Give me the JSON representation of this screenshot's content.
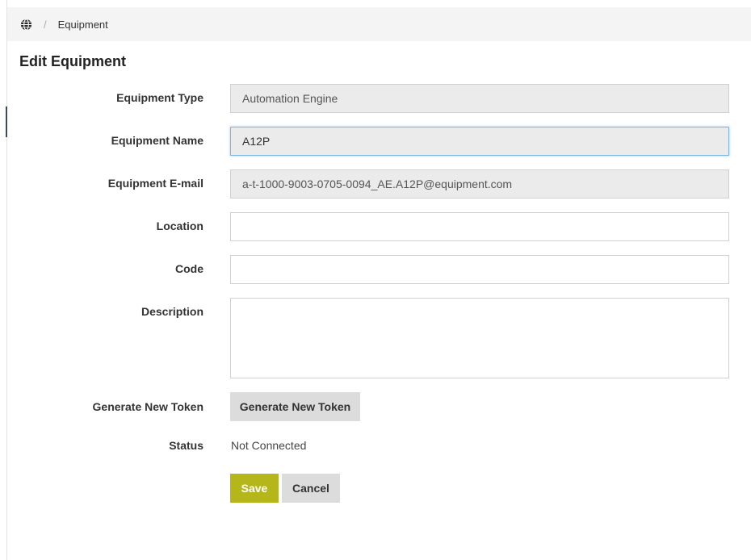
{
  "breadcrumb": {
    "icon": "globe-icon",
    "separator": "/",
    "current": "Equipment"
  },
  "page": {
    "title": "Edit Equipment"
  },
  "form": {
    "equipment_type": {
      "label": "Equipment Type",
      "value": "Automation Engine"
    },
    "equipment_name": {
      "label": "Equipment Name",
      "value": "A12P"
    },
    "equipment_email": {
      "label": "Equipment E-mail",
      "value": "a-t-1000-9003-0705-0094_AE.A12P@equipment.com"
    },
    "location": {
      "label": "Location",
      "value": ""
    },
    "code": {
      "label": "Code",
      "value": ""
    },
    "description": {
      "label": "Description",
      "value": ""
    },
    "token": {
      "label": "Generate New Token",
      "button_label": "Generate New Token"
    },
    "status": {
      "label": "Status",
      "value": "Not Connected"
    }
  },
  "actions": {
    "save_label": "Save",
    "cancel_label": "Cancel"
  },
  "colors": {
    "save_button": "#b5b61a",
    "breadcrumb_bg": "#f4f4f4",
    "readonly_field_bg": "#ebebeb",
    "focus_border": "#7fb5e6"
  }
}
